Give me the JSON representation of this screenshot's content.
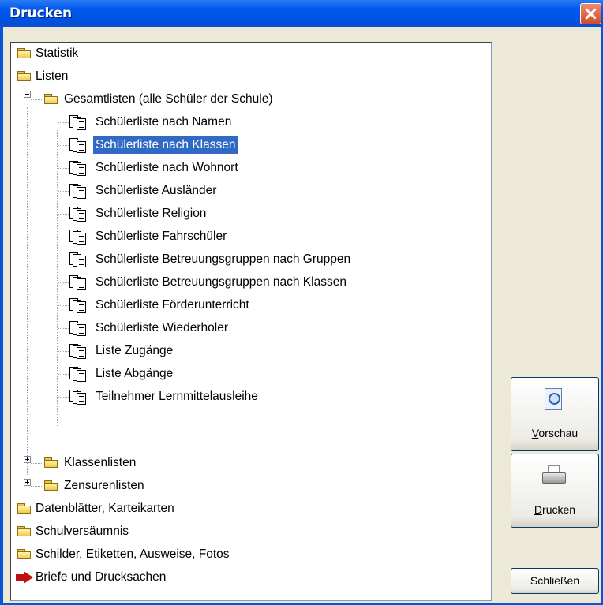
{
  "window": {
    "title": "Drucken"
  },
  "tree": {
    "root_items": [
      {
        "label": "Statistik"
      },
      {
        "label": "Listen"
      }
    ],
    "gesamtlisten": {
      "label": "Gesamtlisten (alle Schüler der Schule)",
      "children": [
        "Schülerliste nach Namen",
        "Schülerliste nach Klassen",
        "Schülerliste nach Wohnort",
        "Schülerliste Ausländer",
        "Schülerliste Religion",
        "Schülerliste Fahrschüler",
        "Schülerliste Betreuungsgruppen nach Gruppen",
        "Schülerliste Betreuungsgruppen nach Klassen",
        "Schülerliste Förderunterricht",
        "Schülerliste Wiederholer",
        "Liste Zugänge",
        "Liste Abgänge",
        "Teilnehmer Lernmittelausleihe"
      ],
      "selected": "Schülerliste nach Klassen"
    },
    "listen_subfolders": [
      "Klassenlisten",
      "Zensurenlisten"
    ],
    "bottom_items": [
      "Datenblätter, Karteikarten",
      "Schulversäumnis",
      "Schilder, Etiketten, Ausweise, Fotos",
      "Briefe und Drucksachen"
    ]
  },
  "buttons": {
    "preview": {
      "label_first": "V",
      "label_rest": "orschau",
      "icon": "preview-icon"
    },
    "print": {
      "label_first": "D",
      "label_rest": "rucken",
      "icon": "printer-icon"
    },
    "close": {
      "label": "Schließen"
    }
  }
}
